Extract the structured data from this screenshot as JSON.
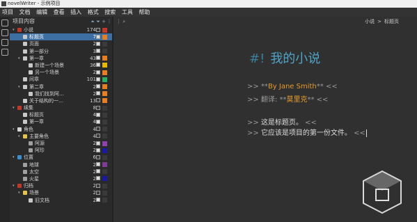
{
  "window": {
    "title": "novelWriter - 示例项目"
  },
  "menu": [
    "项目",
    "文档",
    "编辑",
    "查看",
    "插入",
    "格式",
    "搜索",
    "工具",
    "帮助"
  ],
  "project": {
    "title": "项目内容",
    "tool_icons": [
      "go-up-icon",
      "go-down-icon",
      "add-icon",
      "more-icon"
    ],
    "tree": [
      {
        "label": "小说",
        "count": "174",
        "depth": 0,
        "arrow": "▾",
        "icon": "root-icon",
        "checked": false,
        "status": "#c0392b",
        "selected": false
      },
      {
        "label": "标题页",
        "count": "7",
        "depth": 1,
        "arrow": "",
        "icon": "doc-icon",
        "checked": true,
        "status": "#e67e22",
        "selected": true
      },
      {
        "label": "页面",
        "count": "2",
        "depth": 1,
        "arrow": "",
        "icon": "doc-icon",
        "checked": true,
        "status": "#3a3a3a",
        "selected": false
      },
      {
        "label": "第一部分",
        "count": "3",
        "depth": 1,
        "arrow": "",
        "icon": "doc-icon",
        "checked": true,
        "status": "#3a3a3a",
        "selected": false
      },
      {
        "label": "第一章",
        "count": "43",
        "depth": 1,
        "arrow": "▾",
        "icon": "doc-icon",
        "checked": true,
        "status": "#e67e22",
        "selected": false
      },
      {
        "label": "新建一个场景",
        "count": "36",
        "depth": 2,
        "arrow": "",
        "icon": "doc-icon",
        "checked": true,
        "status": "#e6b800",
        "selected": false
      },
      {
        "label": "另一个场景",
        "count": "2",
        "depth": 2,
        "arrow": "",
        "icon": "doc-icon",
        "checked": true,
        "status": "#e67e22",
        "selected": false
      },
      {
        "label": "间章",
        "count": "101",
        "depth": 1,
        "arrow": "",
        "icon": "doc-icon",
        "checked": true,
        "status": "#27ae60",
        "selected": false
      },
      {
        "label": "第二章",
        "count": "2",
        "depth": 1,
        "arrow": "▾",
        "icon": "doc-icon",
        "checked": true,
        "status": "#e67e22",
        "selected": false
      },
      {
        "label": "我们找到阿…",
        "count": "2",
        "depth": 2,
        "arrow": "",
        "icon": "doc-icon",
        "checked": true,
        "status": "#e67e22",
        "selected": false
      },
      {
        "label": "关于结构的一…",
        "count": "13",
        "depth": 1,
        "arrow": "",
        "icon": "doc-icon",
        "checked": false,
        "status": "#e67e22",
        "selected": false
      },
      {
        "label": "续集",
        "count": "8",
        "depth": 0,
        "arrow": "▾",
        "icon": "root-icon",
        "checked": false,
        "status": "#3a3a3a",
        "selected": false
      },
      {
        "label": "标题页",
        "count": "4",
        "depth": 1,
        "arrow": "",
        "icon": "doc-icon",
        "checked": true,
        "status": "#3a3a3a",
        "selected": false
      },
      {
        "label": "第一章",
        "count": "4",
        "depth": 1,
        "arrow": "",
        "icon": "doc-icon",
        "checked": true,
        "status": "#3a3a3a",
        "selected": false
      },
      {
        "label": "角色",
        "count": "4",
        "depth": 0,
        "arrow": "▾",
        "icon": "character-icon",
        "checked": false,
        "status": "#3a3a3a",
        "selected": false
      },
      {
        "label": "主要角色",
        "count": "4",
        "depth": 1,
        "arrow": "▾",
        "icon": "folder-icon",
        "checked": false,
        "status": "#3a3a3a",
        "selected": false
      },
      {
        "label": "阿源",
        "count": "2",
        "depth": 2,
        "arrow": "",
        "icon": "note-icon",
        "checked": true,
        "status": "#8e44ad",
        "selected": false
      },
      {
        "label": "阿珍",
        "count": "2",
        "depth": 2,
        "arrow": "",
        "icon": "note-icon",
        "checked": true,
        "status": "#1a1aa0",
        "selected": false
      },
      {
        "label": "位置",
        "count": "6",
        "depth": 0,
        "arrow": "▾",
        "icon": "location-icon",
        "checked": false,
        "status": "#3a3a3a",
        "selected": false
      },
      {
        "label": "地球",
        "count": "2",
        "depth": 1,
        "arrow": "",
        "icon": "note-icon",
        "checked": true,
        "status": "#7d3c98",
        "selected": false
      },
      {
        "label": "太空",
        "count": "2",
        "depth": 1,
        "arrow": "",
        "icon": "note-icon",
        "checked": true,
        "status": "#3a3a3a",
        "selected": false
      },
      {
        "label": "火星",
        "count": "2",
        "depth": 1,
        "arrow": "",
        "icon": "note-icon",
        "checked": true,
        "status": "#1a1aa0",
        "selected": false
      },
      {
        "label": "归档",
        "count": "2",
        "depth": 0,
        "arrow": "▾",
        "icon": "archive-icon",
        "checked": false,
        "status": "#3a3a3a",
        "selected": false
      },
      {
        "label": "场景",
        "count": "2",
        "depth": 1,
        "arrow": "▾",
        "icon": "folder-icon",
        "checked": false,
        "status": "#3a3a3a",
        "selected": false
      },
      {
        "label": "旧文档",
        "count": "2",
        "depth": 2,
        "arrow": "",
        "icon": "doc-icon",
        "checked": true,
        "status": "#3a3a3a",
        "selected": false
      }
    ]
  },
  "editor": {
    "breadcrumb": [
      "小说",
      "标题页"
    ],
    "heading_mark": "#!",
    "heading": "我的小说",
    "lines": [
      {
        "pre": ">> **",
        "body": "By Jane Smith",
        "post": "** <<",
        "accent": "#e59b2c"
      },
      {
        "pre": ">> 翻译: **",
        "body": "莫里克",
        "post": "** <<",
        "accent": "#e59b2c"
      },
      {
        "pre": "",
        "body": "",
        "post": "",
        "accent": ""
      },
      {
        "pre": ">> ",
        "body": "这是标题页。",
        "post": " <<",
        "accent": ""
      },
      {
        "pre": ">> ",
        "body": "它应该是项目的第一份文件。",
        "post": " <<",
        "accent": ""
      }
    ]
  },
  "colors": {
    "selection": "#3d6fa3",
    "heading": "#4fa4c8",
    "accent": "#e59b2c"
  }
}
